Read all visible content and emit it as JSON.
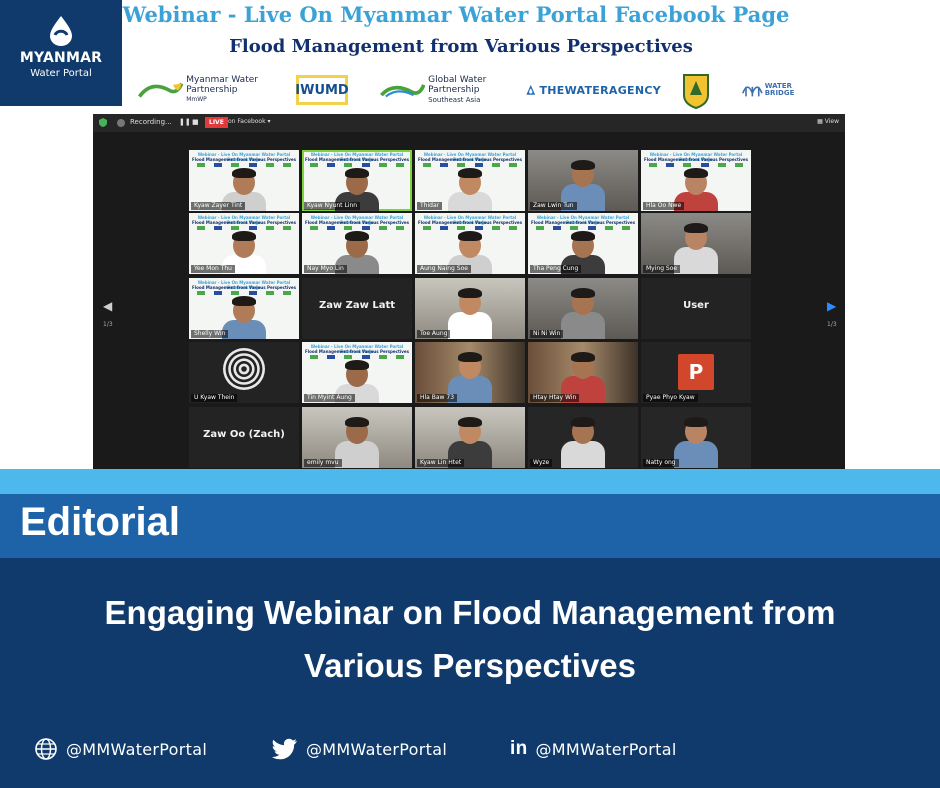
{
  "brand": {
    "name": "MYANMAR",
    "subtitle": "Water Portal"
  },
  "header": {
    "title": "Webinar - Live On Myanmar Water Portal Facebook Page",
    "subtitle": "Flood Management from Various Perspectives"
  },
  "partners": {
    "mwp": "Myanmar Water Partnership",
    "mwp_short": "MmWP",
    "iwumd": "IWUMD",
    "gwp": "Global Water Partnership",
    "gwp_region": "Southeast Asia",
    "twa": "THEWATERAGENCY",
    "forest": "FOREST",
    "wb": "WATER BRIDGE"
  },
  "zoom": {
    "recording": "Recording...",
    "live": "LIVE",
    "on_facebook": "on Facebook ▾",
    "view": "View",
    "page_left": "1/3",
    "page_right": "1/3",
    "slide_title": "Webinar - Live On Myanmar Water Portal Facebook Page",
    "slide_subtitle": "Flood Management from Various Perspectives",
    "participants": [
      "Kyaw Zayer Tint",
      "Kyaw Nyunt Linn",
      "Thidar",
      "Zaw Lwin Tun",
      "Hla Oo Nwe",
      "Yee Mon Thu",
      "Nay Myo Lin",
      "Aung Naing Soe",
      "Tha Peng Cung",
      "Mying Soe",
      "Shelly Win",
      "Zaw Zaw Latt",
      "Toe Aung",
      "Ni Ni Win",
      "User",
      "U Kyaw Thein",
      "Tin Myint Aung",
      "Hla Baw 73",
      "Htay Htay Win",
      "Pyae Phyo Kyaw",
      "Zaw Oo (Zach)",
      "emily mvu",
      "Kyaw Lin Htet",
      "Wyze",
      "Natty ong"
    ],
    "p_letter": "P"
  },
  "editorial": {
    "label": "Editorial",
    "headline_line1": "Engaging Webinar on Flood Management from",
    "headline_line2": "Various Perspectives"
  },
  "social": {
    "web": "@MMWaterPortal",
    "twitter": "@MMWaterPortal",
    "linkedin": "@MMWaterPortal",
    "linkedin_glyph": "in"
  },
  "colors": {
    "navy": "#0f3a6b",
    "mid_blue": "#1e63a8",
    "light_blue": "#4db8ec",
    "title_blue": "#3aa2d6"
  }
}
